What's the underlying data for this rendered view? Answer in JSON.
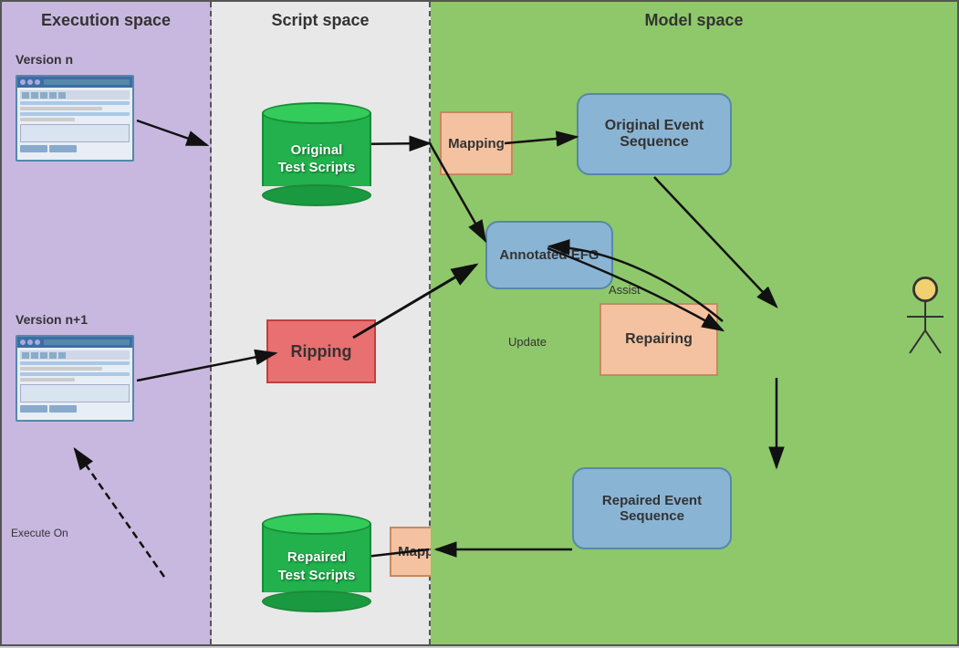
{
  "spaces": {
    "execution": {
      "label": "Execution space"
    },
    "script": {
      "label": "Script space"
    },
    "model": {
      "label": "Model space"
    }
  },
  "versions": {
    "v1": "Version n",
    "v2": "Version n+1"
  },
  "nodes": {
    "original_scripts": "Original\nTest Scripts",
    "mapping_top": "Mapping",
    "original_event_seq": "Original Event\nSequence",
    "annotated_efg": "Annotated\nEFG",
    "ripping": "Ripping",
    "repairing": "Repairing",
    "repaired_event_seq": "Repaired Event\nSequence",
    "mapping_bottom": "Mapping",
    "repaired_scripts": "Repaired\nTest Scripts"
  },
  "arrow_labels": {
    "assist": "Assist",
    "update": "Update",
    "execute_on": "Execute On"
  }
}
